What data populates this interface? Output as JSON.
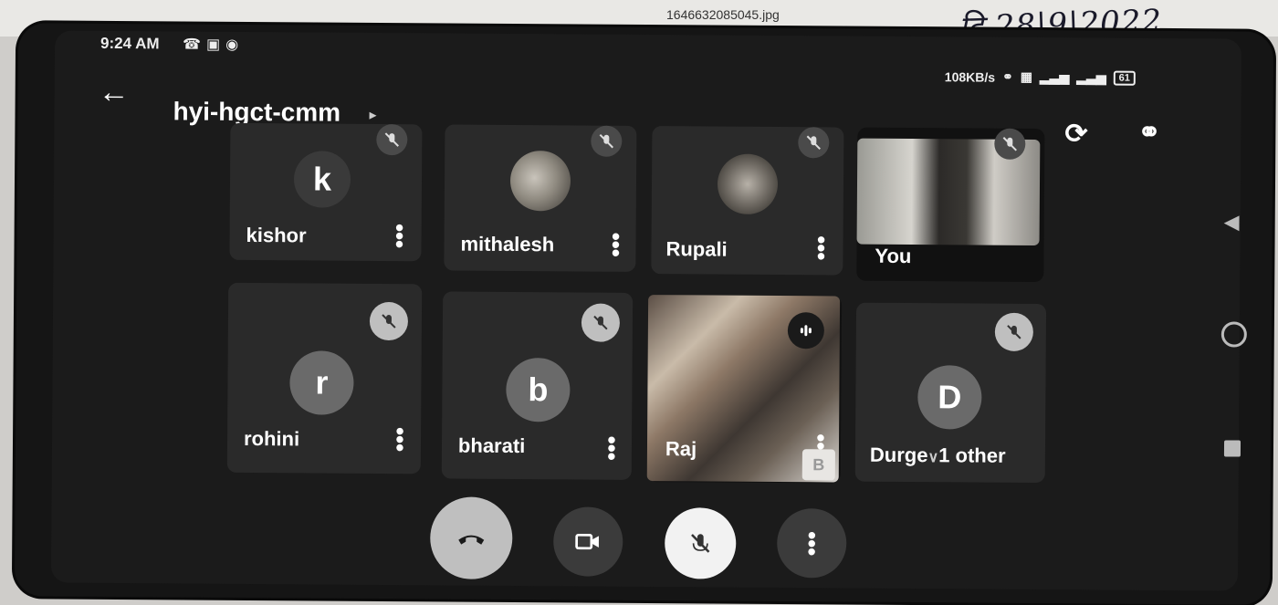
{
  "photo": {
    "filename": "1646632085045.jpg",
    "handwritten_date": "दि.28|9|2022"
  },
  "status_bar": {
    "time": "9:24 AM",
    "left_icons": [
      "whatsapp-icon",
      "app-icon",
      "camera-icon"
    ],
    "data_rate": "108KB/s",
    "right_icons": [
      "headset-icon",
      "vpn-icon",
      "signal-icon",
      "signal-icon",
      "battery-icon"
    ],
    "battery": "61"
  },
  "header": {
    "back_icon": "back-arrow-icon",
    "meeting_code": "hyi-hgct-cmm",
    "actions": [
      "switch-camera-icon",
      "audio-output-icon"
    ]
  },
  "participants": [
    {
      "name": "kishor",
      "initial": "k",
      "muted": true,
      "has_video": false
    },
    {
      "name": "mithalesh",
      "initial": "",
      "muted": true,
      "has_video": false,
      "photo_avatar": true
    },
    {
      "name": "Rupali",
      "initial": "",
      "muted": true,
      "has_video": false,
      "photo_avatar": true
    },
    {
      "name": "You",
      "initial": "",
      "muted": true,
      "has_video": true
    },
    {
      "name": "rohini",
      "initial": "r",
      "muted": true,
      "has_video": false
    },
    {
      "name": "bharati",
      "initial": "b",
      "muted": true,
      "has_video": false
    },
    {
      "name": "Raj",
      "initial": "",
      "muted": false,
      "has_video": true,
      "speaking": true,
      "self_tile_initial": "B"
    },
    {
      "name": "Durge",
      "initial": "D",
      "muted": true,
      "has_video": false,
      "extra": "1 other"
    }
  ],
  "controls": {
    "items": [
      "end-call-icon",
      "camera-icon",
      "mic-off-icon",
      "more-options-icon"
    ]
  },
  "nav_bar": [
    "back-triangle-icon",
    "home-circle-icon",
    "recents-square-icon"
  ]
}
